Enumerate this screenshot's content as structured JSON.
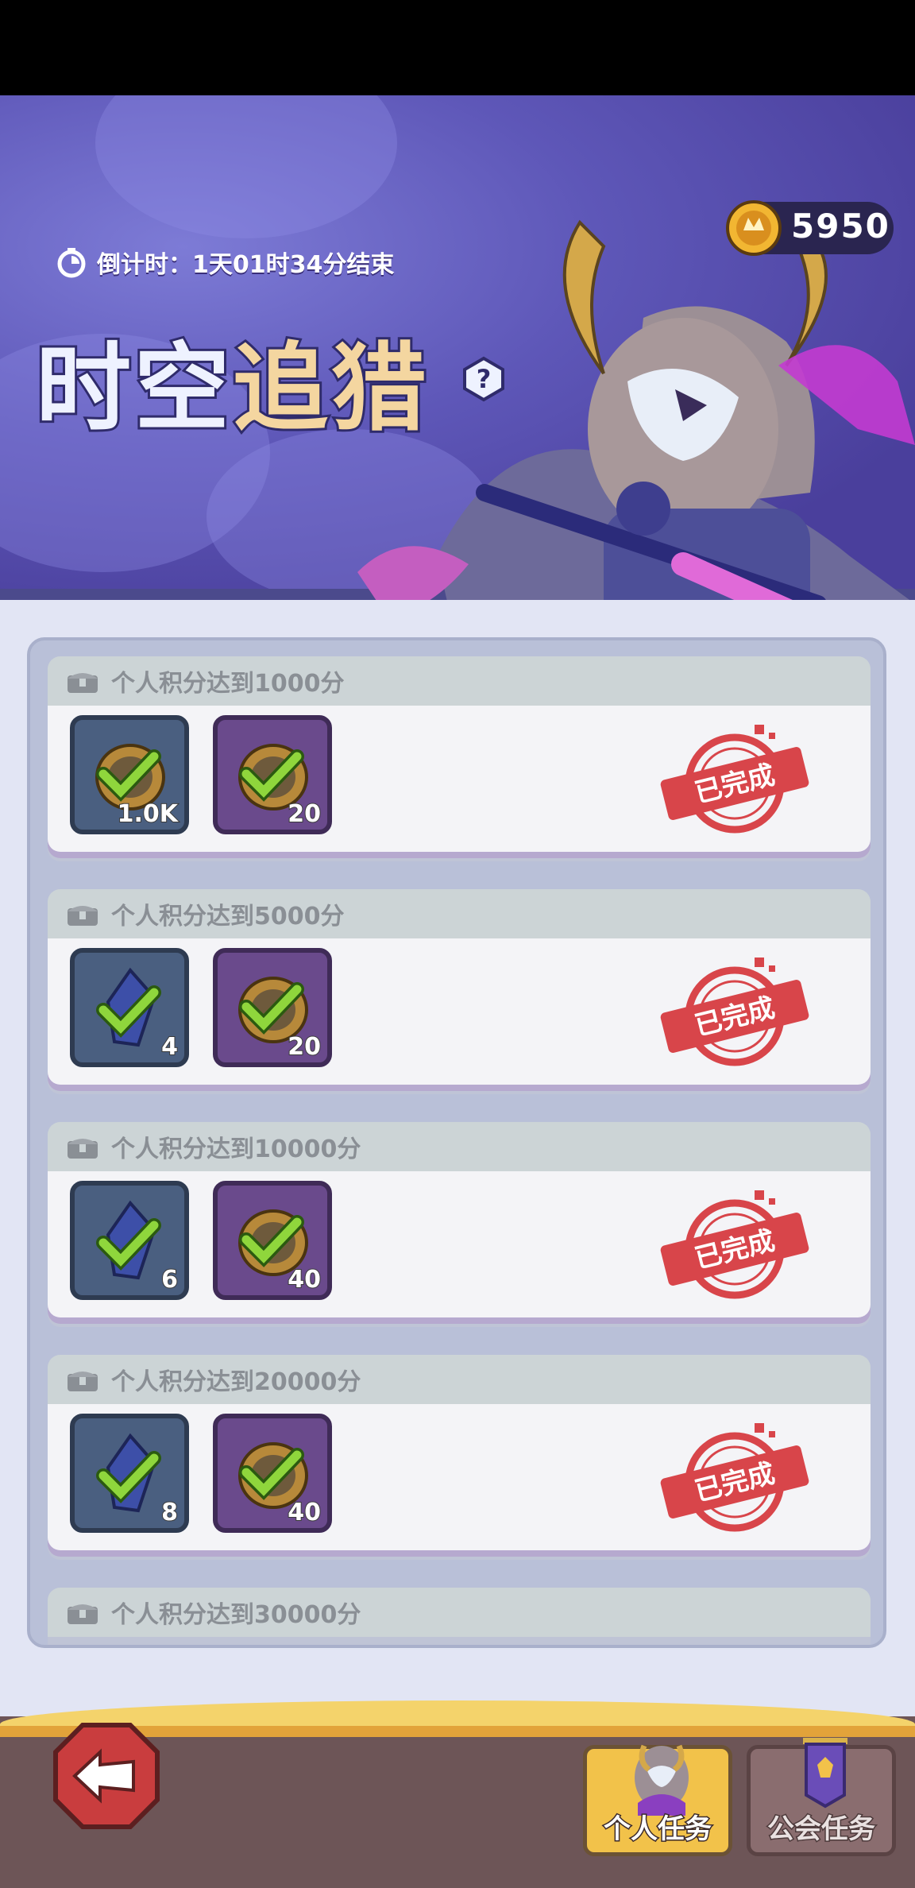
{
  "header": {
    "countdown": "倒计时：1天01时34分结束",
    "title_part1": "时空",
    "title_part2": "追猎",
    "coins": "5950"
  },
  "tasks": [
    {
      "label": "个人积分达到1000分",
      "rewards": [
        {
          "qty": "1.0K",
          "frame": "blue"
        },
        {
          "qty": "20",
          "frame": "purple"
        }
      ],
      "status": "已完成"
    },
    {
      "label": "个人积分达到5000分",
      "rewards": [
        {
          "qty": "4",
          "frame": "blue"
        },
        {
          "qty": "20",
          "frame": "purple"
        }
      ],
      "status": "已完成"
    },
    {
      "label": "个人积分达到10000分",
      "rewards": [
        {
          "qty": "6",
          "frame": "blue"
        },
        {
          "qty": "40",
          "frame": "purple"
        }
      ],
      "status": "已完成"
    },
    {
      "label": "个人积分达到20000分",
      "rewards": [
        {
          "qty": "8",
          "frame": "blue"
        },
        {
          "qty": "40",
          "frame": "purple"
        }
      ],
      "status": "已完成"
    },
    {
      "label": "个人积分达到30000分"
    }
  ],
  "nav": {
    "personal_tab": "个人任务",
    "guild_tab": "公会任务"
  },
  "colors": {
    "banner": "#5e57b8",
    "stamp_red": "#d8454a",
    "check_green": "#8fd63c",
    "tab_active": "#f2c24a"
  }
}
